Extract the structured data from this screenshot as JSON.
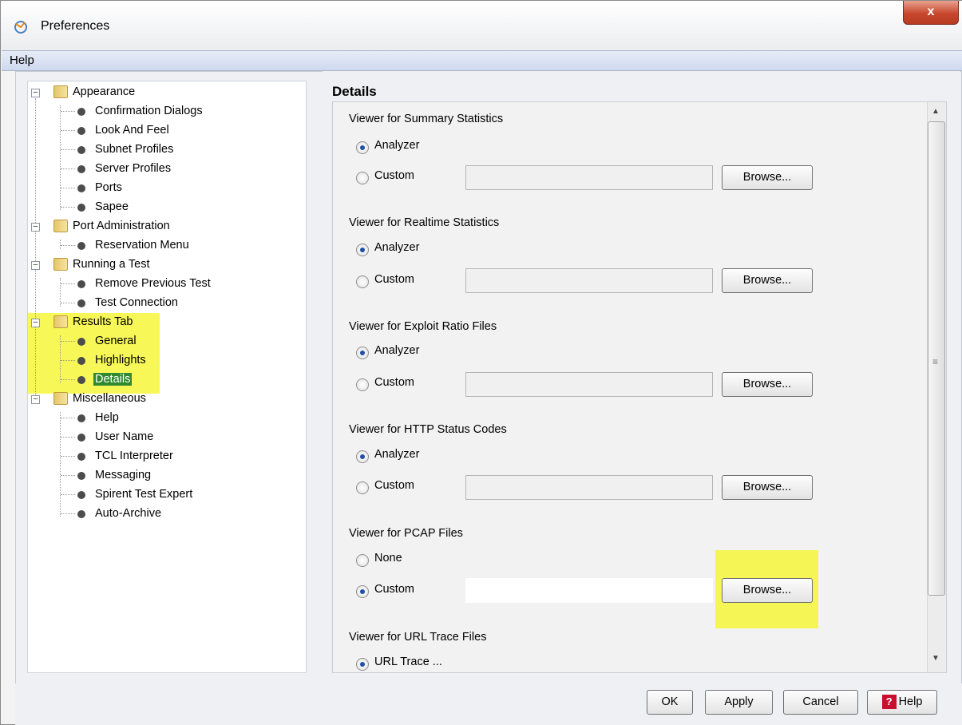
{
  "window": {
    "title": "Preferences",
    "close_label": "x"
  },
  "menu": {
    "help_label": "Help"
  },
  "tree": {
    "groups": [
      {
        "label": "Appearance",
        "children": [
          "Confirmation Dialogs",
          "Look And Feel",
          "Subnet Profiles",
          "Server Profiles",
          "Ports",
          "Sapee"
        ]
      },
      {
        "label": "Port Administration",
        "children": [
          "Reservation Menu"
        ]
      },
      {
        "label": "Running a Test",
        "children": [
          "Remove Previous Test",
          "Test Connection"
        ]
      },
      {
        "label": "Results Tab",
        "children": [
          "General",
          "Highlights",
          "Details"
        ]
      },
      {
        "label": "Miscellaneous",
        "children": [
          "Help",
          "User Name",
          "TCL Interpreter",
          "Messaging",
          "Spirent Test Expert",
          "Auto-Archive"
        ]
      }
    ],
    "selected": "Details"
  },
  "details": {
    "title": "Details",
    "groups": [
      {
        "label": "Viewer for Summary Statistics",
        "options": [
          "Analyzer",
          "Custom"
        ],
        "selected": "Analyzer",
        "browse_label": "Browse..."
      },
      {
        "label": "Viewer for Realtime Statistics",
        "options": [
          "Analyzer",
          "Custom"
        ],
        "selected": "Analyzer",
        "browse_label": "Browse..."
      },
      {
        "label": "Viewer for Exploit Ratio Files",
        "options": [
          "Analyzer",
          "Custom"
        ],
        "selected": "Analyzer",
        "browse_label": "Browse..."
      },
      {
        "label": "Viewer for HTTP Status Codes",
        "options": [
          "Analyzer",
          "Custom"
        ],
        "selected": "Analyzer",
        "browse_label": "Browse..."
      },
      {
        "label": "Viewer for PCAP Files",
        "options": [
          "None",
          "Custom"
        ],
        "selected": "Custom",
        "browse_label": "Browse..."
      },
      {
        "label": "Viewer for URL Trace Files",
        "options": [
          "URL Trace ..."
        ],
        "selected": "URL Trace ..."
      }
    ]
  },
  "footer": {
    "ok_label": "OK",
    "apply_label": "Apply",
    "cancel_label": "Cancel",
    "help_label": "Help",
    "help_icon": "?"
  },
  "colors": {
    "highlight": "#f6f63b",
    "selection": "#2f8a2f",
    "radio_dot": "#1f4fa7"
  }
}
